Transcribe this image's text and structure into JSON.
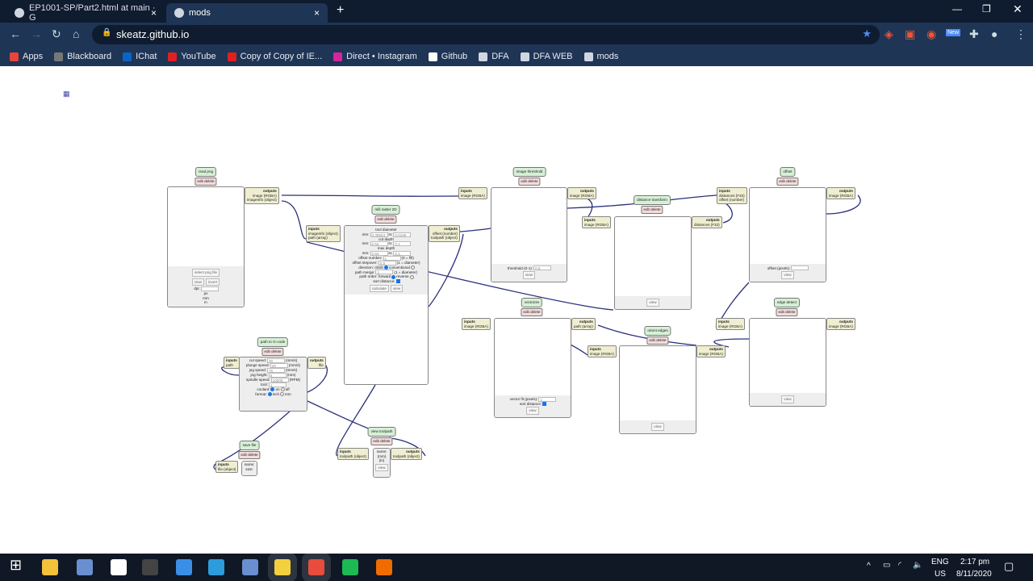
{
  "browser": {
    "tabs": [
      {
        "label": "EP1001-SP/Part2.html at main · G",
        "icon": "github-icon",
        "active": false
      },
      {
        "label": "mods",
        "icon": "globe-icon",
        "active": true
      }
    ],
    "new_tab": "+",
    "close": "×",
    "url": "skeatz.github.io",
    "bookmarks": [
      {
        "label": "Apps",
        "color": "#e8453c"
      },
      {
        "label": "Blackboard",
        "color": "#777777"
      },
      {
        "label": "IChat",
        "color": "#0a64c8"
      },
      {
        "label": "YouTube",
        "color": "#e02020"
      },
      {
        "label": "Copy of Copy of IE...",
        "color": "#e02020"
      },
      {
        "label": "Direct • Instagram",
        "color": "#d6249f"
      },
      {
        "label": "Github",
        "color": "#ffffff"
      },
      {
        "label": "DFA",
        "color": "#cfd6e0"
      },
      {
        "label": "DFA WEB",
        "color": "#cfd6e0"
      },
      {
        "label": "mods",
        "color": "#cfd6e0"
      }
    ],
    "extension_badge": "New"
  },
  "page": {
    "menu_icon": "grid-icon"
  },
  "modules": [
    {
      "id": "read_png",
      "title": "read png",
      "edit": "edit delete",
      "outputs": [
        "outputs",
        "image (RGBA)",
        "imageInfo (object)"
      ],
      "content": [
        [
          {
            "b": "select png file"
          }
        ],
        [
          {
            "b": "view"
          },
          {
            "b": "invert"
          }
        ],
        [
          {
            "t": "dpi:"
          },
          {
            "i": ""
          }
        ],
        [
          {
            "t": "px"
          }
        ],
        [
          {
            "t": "mm"
          }
        ],
        [
          {
            "t": "in"
          }
        ]
      ]
    },
    {
      "id": "mill_raster",
      "title": "mill raster 2D",
      "edit": "edit delete",
      "inputs": [
        "inputs",
        "imageInfo (object)",
        "path (array)"
      ],
      "outputs": [
        "outputs",
        "offset (number)",
        "toolpath (object)"
      ],
      "content": [
        [
          {
            "t": "tool diameter"
          }
        ],
        [
          {
            "t": "mm:"
          },
          {
            "i": "0.39624"
          },
          {
            "t": "in:"
          },
          {
            "i": "0.0156"
          }
        ],
        [
          {
            "t": "cut depth"
          }
        ],
        [
          {
            "t": "mm:"
          },
          {
            "i": "2.54"
          },
          {
            "t": "in:"
          },
          {
            "i": "0.1"
          }
        ],
        [
          {
            "t": "max depth"
          }
        ],
        [
          {
            "t": "mm:"
          },
          {
            "i": "2.54"
          },
          {
            "t": "in:"
          },
          {
            "i": "0.1"
          }
        ],
        [
          {
            "t": "offset number:"
          },
          {
            "i": "1"
          },
          {
            "t": "(0 = fill)"
          }
        ],
        [
          {
            "t": "offset stepover:"
          },
          {
            "i": "0.5"
          },
          {
            "t": "(1 = diameter)"
          }
        ],
        [
          {
            "t": "direction: climb"
          },
          {
            "r": true
          },
          {
            "t": "conventional"
          },
          {
            "r": false
          }
        ],
        [
          {
            "t": "path merge:"
          },
          {
            "i": "1"
          },
          {
            "t": "(1 = diameter)"
          }
        ],
        [
          {
            "t": "path order: forward"
          },
          {
            "r": true
          },
          {
            "t": "reverse"
          },
          {
            "r": false
          }
        ],
        [
          {
            "t": "sort distance:"
          },
          {
            "c": true
          }
        ],
        [
          {
            "b": "calculate"
          },
          {
            "b": "view"
          }
        ]
      ]
    },
    {
      "id": "image_threshold",
      "title": "image threshold",
      "edit": "edit delete",
      "inputs": [
        "inputs",
        "image (RGBA)"
      ],
      "outputs": [
        "outputs",
        "image (RGBA)"
      ],
      "content": [
        [
          {
            "t": "threshold (0-1):"
          },
          {
            "i": "0.5"
          }
        ],
        [
          {
            "b": "view"
          }
        ]
      ]
    },
    {
      "id": "distance_transform",
      "title": "distance transform",
      "edit": "edit delete",
      "inputs": [
        "inputs",
        "image (RGBA)"
      ],
      "outputs": [
        "outputs",
        "distances (F32)"
      ],
      "content": [
        [
          {
            "b": "view"
          }
        ]
      ]
    },
    {
      "id": "offset",
      "title": "offset",
      "edit": "edit delete",
      "inputs": [
        "inputs",
        "distances (F32)",
        "offset (number)"
      ],
      "outputs": [
        "outputs",
        "image (RGBA)"
      ],
      "content": [
        [
          {
            "t": "offset (pixels):"
          },
          {
            "i": ""
          }
        ],
        [
          {
            "b": "view"
          }
        ]
      ]
    },
    {
      "id": "vectorize",
      "title": "vectorize",
      "edit": "edit delete",
      "inputs": [
        "inputs",
        "image (RGBA)"
      ],
      "outputs": [
        "outputs",
        "path (array)"
      ],
      "content": [
        [
          {
            "t": "vector fit (pixels):"
          },
          {
            "i": "1"
          }
        ],
        [
          {
            "t": "sort distance:"
          },
          {
            "c": true
          }
        ],
        [
          {
            "b": "view"
          }
        ]
      ]
    },
    {
      "id": "edge_detect",
      "title": "edge detect",
      "edit": "edit delete",
      "inputs": [
        "inputs",
        "image (RGBA)"
      ],
      "outputs": [
        "outputs",
        "image (RGBA)"
      ],
      "content": [
        [
          {
            "b": "view"
          }
        ]
      ]
    },
    {
      "id": "orient_edges",
      "title": "orient edges",
      "edit": "edit delete",
      "inputs": [
        "inputs",
        "image (RGBA)"
      ],
      "outputs": [
        "outputs",
        "image (RGBA)"
      ],
      "content": [
        [
          {
            "b": "view"
          }
        ]
      ]
    },
    {
      "id": "path_gcode",
      "title": "path to G-code",
      "edit": "edit delete",
      "inputs": [
        "inputs",
        "path"
      ],
      "outputs": [
        "outputs",
        "file"
      ],
      "content": [
        [
          {
            "t": "cut speed:"
          },
          {
            "i": "20"
          },
          {
            "t": "(mm/s)"
          }
        ],
        [
          {
            "t": "plunge speed:"
          },
          {
            "i": "20"
          },
          {
            "t": "(mm/s)"
          }
        ],
        [
          {
            "t": "jog speed:"
          },
          {
            "i": "75"
          },
          {
            "t": "(mm/s)"
          }
        ],
        [
          {
            "t": "jog height:"
          },
          {
            "i": "5"
          },
          {
            "t": "(mm)"
          }
        ],
        [
          {
            "t": "spindle speed:"
          },
          {
            "i": "10000"
          },
          {
            "t": "(RPM)"
          }
        ],
        [
          {
            "t": "tool:"
          },
          {
            "i": "1"
          }
        ],
        [
          {
            "t": "coolant:"
          },
          {
            "r": true
          },
          {
            "t": "on"
          },
          {
            "r": false
          },
          {
            "t": "off"
          }
        ],
        [
          {
            "t": "format:"
          },
          {
            "r": true
          },
          {
            "t": "inch"
          },
          {
            "r": false
          },
          {
            "t": "mm"
          }
        ]
      ]
    },
    {
      "id": "view_toolpath",
      "title": "view toolpath",
      "edit": "edit delete",
      "inputs": [
        "inputs",
        "toolpath (object)"
      ],
      "outputs": [
        "outputs",
        "toolpath (object)"
      ],
      "content": [
        [
          {
            "t": "name:"
          }
        ],
        [
          {
            "t": "(mm)"
          }
        ],
        [
          {
            "t": "(in)"
          }
        ],
        [
          {
            "b": "view"
          }
        ]
      ]
    },
    {
      "id": "save_file",
      "title": "save file",
      "edit": "edit delete",
      "inputs": [
        "inputs",
        "file (object)"
      ],
      "content": [
        [
          {
            "t": "name:"
          }
        ],
        [
          {
            "t": "size:"
          }
        ]
      ]
    }
  ],
  "taskbar": {
    "apps": [
      "start",
      "file-explorer",
      "notepad",
      "feedback",
      "terminal",
      "photos",
      "skype",
      "paint",
      "sticky-notes",
      "chrome",
      "spotify",
      "sublime"
    ],
    "lang": "ENG",
    "region": "US",
    "time": "2:17 pm",
    "date": "8/11/2020",
    "accent": "#f0a020"
  }
}
